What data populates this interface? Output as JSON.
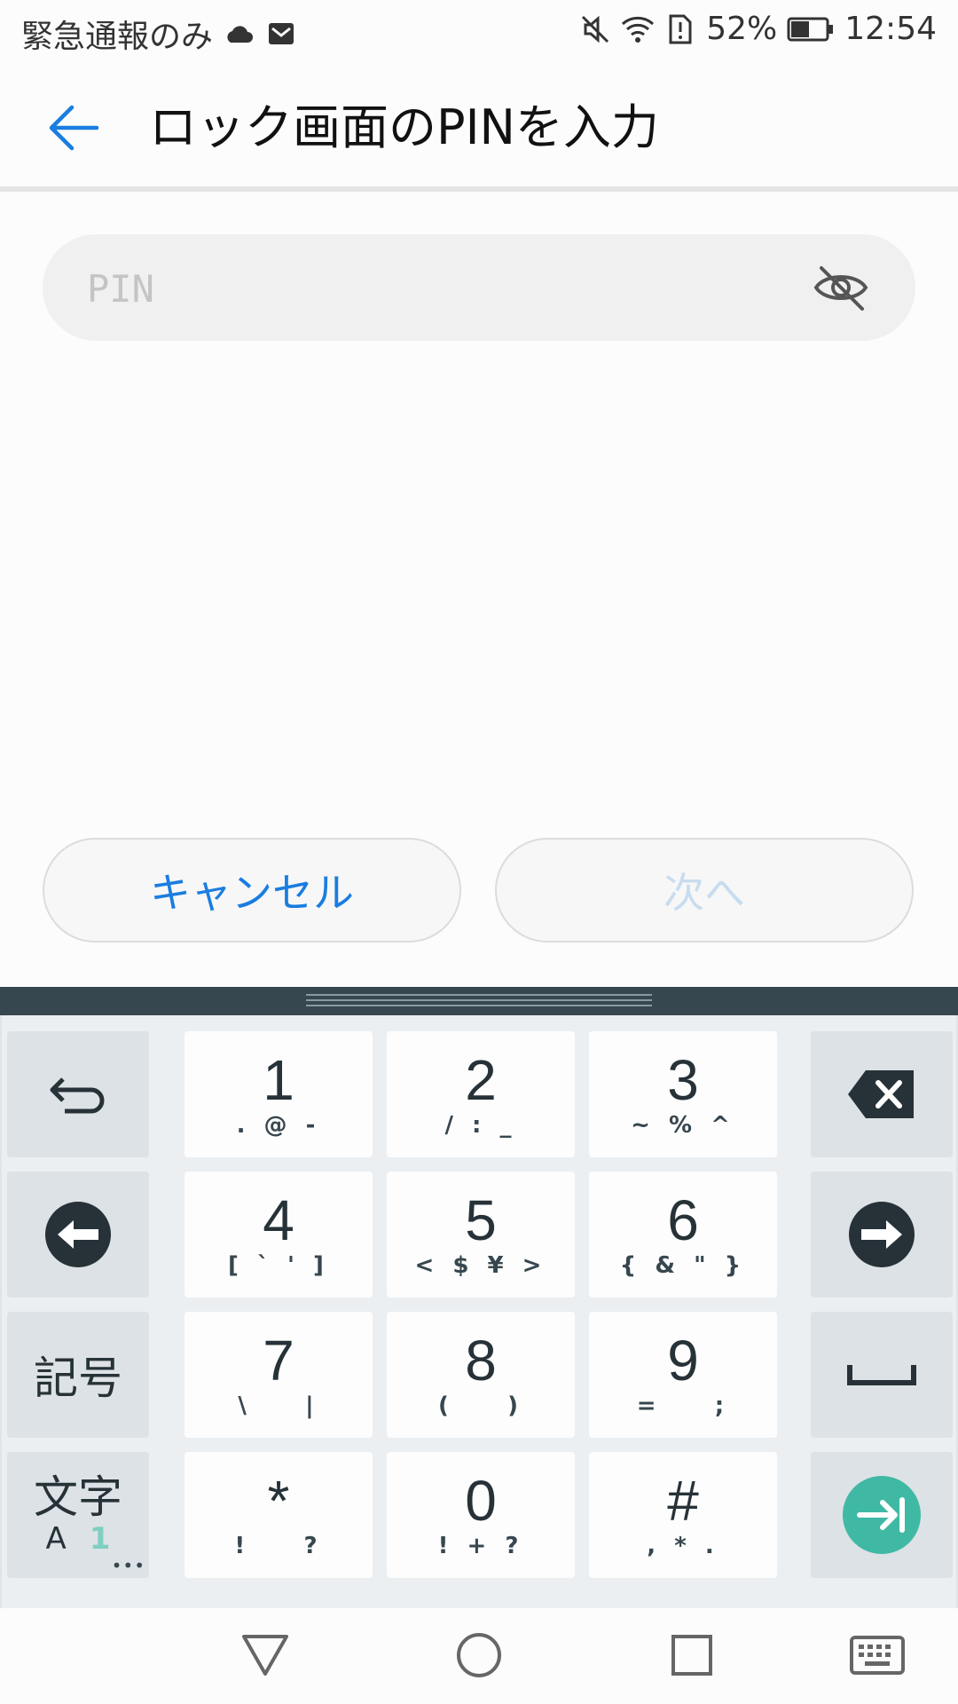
{
  "status_bar": {
    "left_text": "緊急通報のみ",
    "left_icons": [
      "cloud-icon",
      "mail-icon"
    ],
    "right_icons": [
      "mute-icon",
      "wifi-icon",
      "sim-alert-icon"
    ],
    "battery_percent": "52%",
    "battery_level": 0.52,
    "time": "12:54"
  },
  "app_bar": {
    "back_icon": "arrow-left-icon",
    "title": "ロック画面のPINを入力"
  },
  "pin_field": {
    "placeholder": "PIN",
    "value": "",
    "visibility_icon": "eye-off-icon"
  },
  "buttons": {
    "cancel_label": "キャンセル",
    "next_label": "次へ"
  },
  "colors": {
    "accent": "#1a7de0",
    "disabled_text": "#c8dcef",
    "keyboard_header": "#37474f",
    "enter_key": "#3fb9a4"
  },
  "keyboard": {
    "keys": [
      {
        "main": "1",
        "sub": ". @ -"
      },
      {
        "main": "2",
        "sub": "/ : _"
      },
      {
        "main": "3",
        "sub": "~ % ^"
      },
      {
        "main": "4",
        "sub": "[ ` ' ]"
      },
      {
        "main": "5",
        "sub": "< $ ¥ >"
      },
      {
        "main": "6",
        "sub": "{ & \" }"
      },
      {
        "main": "7",
        "sub": "\\    |"
      },
      {
        "main": "8",
        "sub": "(    )"
      },
      {
        "main": "9",
        "sub": "=    ;"
      },
      {
        "main": "*",
        "sub": "!    ?"
      },
      {
        "main": "0",
        "sub": "! + ?"
      },
      {
        "main": "#",
        "sub": ", * ."
      }
    ],
    "kigou_label": "記号",
    "moji_top": "文字",
    "moji_a": "A",
    "moji_one": "1",
    "moji_dots": "•••",
    "func_icons": [
      "undo-icon",
      "backspace-icon",
      "cursor-left-icon",
      "cursor-right-icon",
      "space-icon",
      "enter-icon"
    ]
  },
  "nav_bar": {
    "icons": [
      "nav-back-icon",
      "nav-home-icon",
      "nav-recents-icon",
      "keyboard-icon"
    ]
  }
}
